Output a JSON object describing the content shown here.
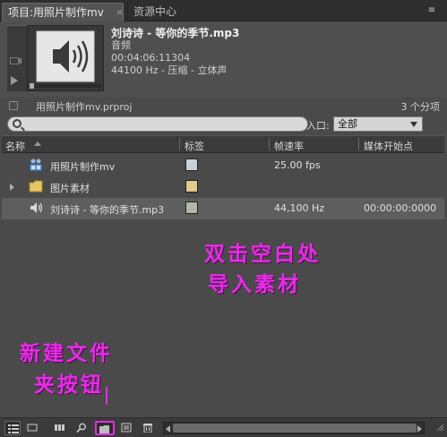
{
  "tabs": [
    {
      "label": "项目:用照片制作mv",
      "active": true
    },
    {
      "label": "资源中心",
      "active": false
    }
  ],
  "tab_close": "×",
  "panel_menu": "≡",
  "preview": {
    "name": "刘诗诗 - 等你的季节.mp3",
    "type": "音频",
    "duration": "00:04:06:11304",
    "format": "44100 Hz - 压缩 - 立体声"
  },
  "project": {
    "file": "用照片制作mv.prproj",
    "count": "3 个分项"
  },
  "search": {
    "value": "",
    "entry_label": "入口:",
    "entry_value": "全部"
  },
  "columns": {
    "name": "名称",
    "label": "标签",
    "frame_rate": "帧速率",
    "media_start": "媒体开始点"
  },
  "items": [
    {
      "name": "用照片制作mv",
      "icon": "sequence-icon",
      "label_color": "#c9d3d7",
      "frame_rate": "25.00 fps",
      "media_start": "",
      "expandable": false,
      "selected": false
    },
    {
      "name": "图片素材",
      "icon": "folder-icon",
      "label_color": "#e2c98a",
      "frame_rate": "",
      "media_start": "",
      "expandable": true,
      "selected": false
    },
    {
      "name": "刘诗诗 - 等你的季节.mp3",
      "icon": "audio-icon",
      "label_color": "#aebaa7",
      "frame_rate": "44,100 Hz",
      "media_start": "00:00:00:0000",
      "expandable": false,
      "selected": true
    }
  ],
  "annotations": {
    "line1": "双击空白处",
    "line2": "导入素材",
    "line3": "新建文件",
    "line4": "夹按钮",
    "color": "#e62de6"
  },
  "toolbar": {
    "buttons": [
      "list-view-icon",
      "icon-view-icon",
      "automate-to-sequence-icon",
      "find-icon",
      "new-bin-icon",
      "new-item-icon",
      "clear-icon"
    ]
  }
}
